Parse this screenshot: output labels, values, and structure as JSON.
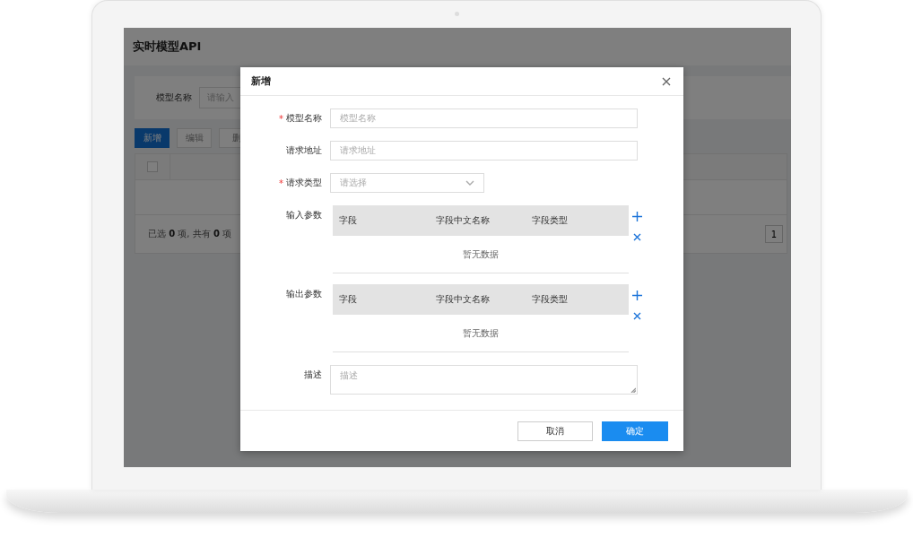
{
  "window": {
    "title": "实时模型API"
  },
  "filter": {
    "label": "模型名称",
    "placeholder": "请输入"
  },
  "toolbar": [
    {
      "label": "新增",
      "primary": true
    },
    {
      "label": "编辑",
      "primary": false
    },
    {
      "label": "删",
      "primary": false
    }
  ],
  "table": {
    "select_all_checked": false,
    "footer": "已选 **0** 项, 共有 **0** 项",
    "page": "1"
  },
  "dialog": {
    "title": "新增",
    "fields": [
      {
        "kind": "input",
        "label": "模型名称",
        "required_mark": "*",
        "placeholder": "模型名称"
      },
      {
        "kind": "input",
        "label": "请求地址",
        "placeholder": "请求地址"
      },
      {
        "kind": "select",
        "label": "请求类型",
        "required_mark": "*",
        "placeholder": "请选择"
      },
      {
        "kind": "params",
        "label": "输入参数",
        "columns": [
          "字段",
          "字段中文名称",
          "字段类型"
        ],
        "empty": "暂无数据"
      },
      {
        "kind": "params",
        "label": "输出参数",
        "columns": [
          "字段",
          "字段中文名称",
          "字段类型"
        ],
        "empty": "暂无数据"
      },
      {
        "kind": "textarea",
        "label": "描述",
        "placeholder": "描述"
      }
    ],
    "buttons": [
      {
        "label": "取消",
        "primary": false
      },
      {
        "label": "确定",
        "primary": true
      }
    ]
  }
}
